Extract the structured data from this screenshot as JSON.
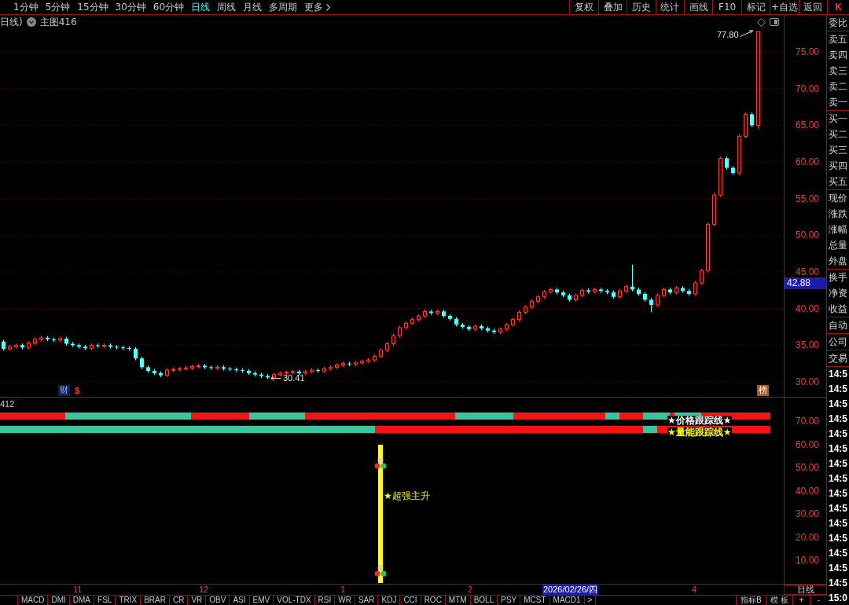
{
  "toolbar": {
    "periods": [
      {
        "label": "1分钟",
        "selected": false
      },
      {
        "label": "5分钟",
        "selected": false
      },
      {
        "label": "15分钟",
        "selected": false
      },
      {
        "label": "30分钟",
        "selected": false
      },
      {
        "label": "60分钟",
        "selected": false
      },
      {
        "label": "日线",
        "selected": true
      },
      {
        "label": "周线",
        "selected": false
      },
      {
        "label": "月线",
        "selected": false
      },
      {
        "label": "多周期",
        "selected": false
      }
    ],
    "more": "更多",
    "tools": [
      "复权",
      "叠加",
      "历史",
      "统计",
      "画线",
      "F10",
      "标记",
      "+自选",
      "返回"
    ],
    "mode_tab": "K"
  },
  "chart_header": {
    "period": "日线)",
    "indicator": "主图416"
  },
  "price_chart": {
    "axis_ticks": [
      "75.00",
      "70.00",
      "65.00",
      "60.00",
      "55.00",
      "50.00",
      "45.00",
      "40.00",
      "35.00",
      "30.00"
    ],
    "current_price": "42.88",
    "high_label": "77.80",
    "low_label": "30.41",
    "badges": [
      {
        "text": "财",
        "kind": "finance"
      },
      {
        "text": "$",
        "kind": "dividend"
      },
      {
        "text": "榜",
        "kind": "ranking"
      }
    ]
  },
  "indicator": {
    "title": "412",
    "tracks": [
      {
        "label": "★价格跟踪线★",
        "kind": "price"
      },
      {
        "label": "★量能跟踪线★",
        "kind": "volume"
      }
    ],
    "signal": {
      "label": "★超强主升"
    },
    "axis_ticks": [
      "70.00",
      "60.00",
      "50.00",
      "40.00",
      "30.00",
      "20.00",
      "10.00"
    ]
  },
  "date_axis": {
    "labels": [
      {
        "text": "11",
        "kind": "month"
      },
      {
        "text": "12",
        "kind": "month"
      },
      {
        "text": "1",
        "kind": "month"
      },
      {
        "text": "2",
        "kind": "month"
      },
      {
        "text": "2026/02/26/四",
        "kind": "cursor"
      },
      {
        "text": "4",
        "kind": "month"
      }
    ],
    "period_button": "日线"
  },
  "indicator_tabs": [
    "MACD",
    "DMI",
    "DMA",
    "FSL",
    "TRIX",
    "BRAR",
    "CR",
    "VR",
    "OBV",
    "ASI",
    "EMV",
    "VOL-TDX",
    "RSI",
    "WR",
    "SAR",
    "KDJ",
    "CCI",
    "ROC",
    "MTM",
    "BOLL",
    "PSY",
    "MCST",
    "MACD1",
    ">"
  ],
  "side_tabs": [
    "指标B",
    "模 板"
  ],
  "step_buttons": [
    "+",
    "-"
  ],
  "quote_panel": {
    "groups": [
      {
        "rows": [
          "委比"
        ]
      },
      {
        "rows": [
          "卖五",
          "卖四",
          "卖三",
          "卖二",
          "卖一"
        ]
      },
      {
        "rows": [
          "买一",
          "买二",
          "买三",
          "买四",
          "买五"
        ]
      },
      {
        "rows": [
          "现价",
          "涨跌",
          "涨幅",
          "总量",
          "外盘"
        ]
      },
      {
        "rows": [
          "换手",
          "净资",
          "收益"
        ]
      },
      {
        "rows": [
          "自动"
        ]
      },
      {
        "rows": [
          "公司"
        ]
      },
      {
        "rows": [
          "交易"
        ]
      }
    ],
    "times": [
      "14:5",
      "14:5",
      "14:5",
      "14:5",
      "14:5",
      "14:5",
      "14:5",
      "14:5",
      "14:5",
      "14:5",
      "14:5",
      "14:5",
      "14:5",
      "14:5",
      "14:5",
      "15:0"
    ]
  }
}
